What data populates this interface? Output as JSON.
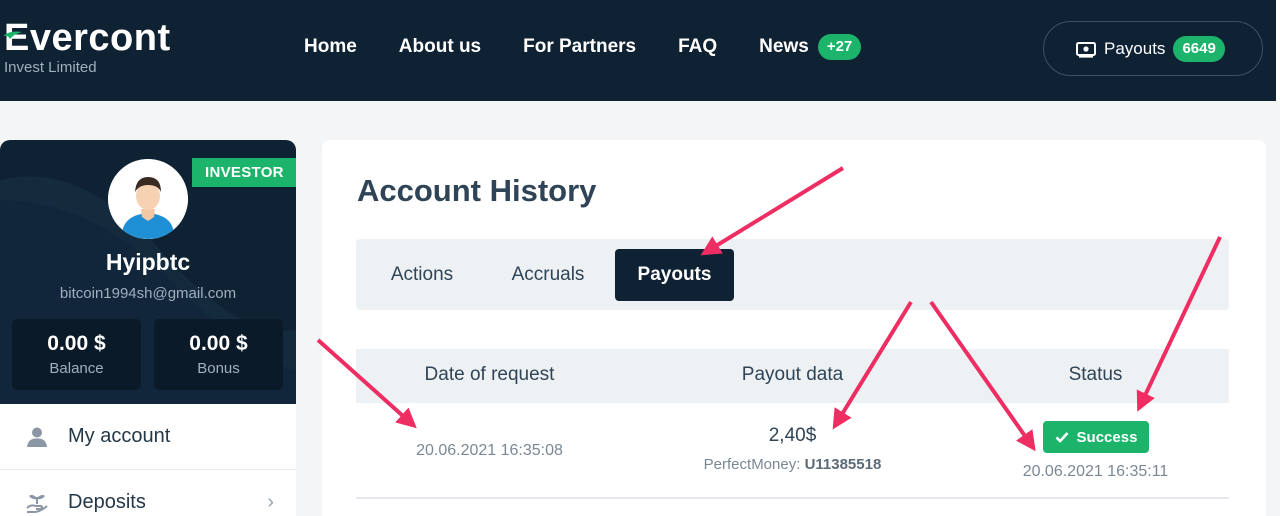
{
  "header": {
    "logo_text": "Evercont",
    "logo_subtitle": "Invest Limited",
    "nav": [
      "Home",
      "About us",
      "For Partners",
      "FAQ",
      "News"
    ],
    "news_badge": "+27",
    "payouts_label": "Payouts",
    "payouts_badge": "6649",
    "colors": {
      "background": "#0f2233",
      "accent": "#1cb46a"
    }
  },
  "sidebar": {
    "role_badge": "INVESTOR",
    "username": "Hyipbtc",
    "email": "bitcoin1994sh@gmail.com",
    "stats": [
      {
        "value": "0.00 $",
        "label": "Balance"
      },
      {
        "value": "0.00 $",
        "label": "Bonus"
      }
    ],
    "menu": [
      {
        "label": "My account",
        "icon": "user-icon"
      },
      {
        "label": "Deposits",
        "icon": "hand-plant-icon"
      }
    ]
  },
  "main": {
    "title": "Account History",
    "tabs": [
      {
        "label": "Actions",
        "active": false
      },
      {
        "label": "Accruals",
        "active": false
      },
      {
        "label": "Payouts",
        "active": true
      }
    ],
    "table": {
      "headers": [
        "Date of request",
        "Payout data",
        "Status"
      ],
      "rows": [
        {
          "date": "20.06.2021 16:35:08",
          "amount": "2,40$",
          "system_label": "PerfectMoney:",
          "wallet": "U11385518",
          "status": "Success",
          "status_date": "20.06.2021 16:35:11"
        }
      ]
    }
  },
  "annotations": {
    "arrow_color": "#ee2d63"
  }
}
